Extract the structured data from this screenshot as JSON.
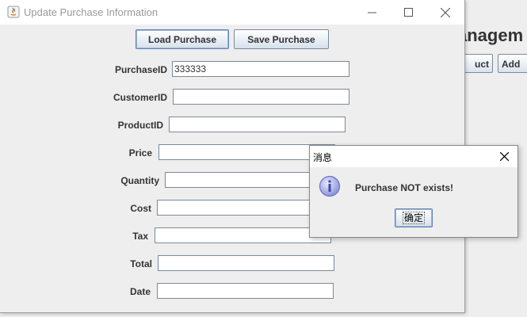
{
  "background_window": {
    "title_fragment": "anagem",
    "buttons": [
      "uct",
      "Add"
    ]
  },
  "window": {
    "title": "Update Purchase Information",
    "buttons": {
      "load": "Load Purchase",
      "save": "Save Purchase"
    }
  },
  "fields": [
    {
      "label": "PurchaseID",
      "value": "333333"
    },
    {
      "label": "CustomerID",
      "value": ""
    },
    {
      "label": "ProductID",
      "value": ""
    },
    {
      "label": "Price",
      "value": ""
    },
    {
      "label": "Quantity",
      "value": ""
    },
    {
      "label": "Cost",
      "value": ""
    },
    {
      "label": "Tax",
      "value": ""
    },
    {
      "label": "Total",
      "value": ""
    },
    {
      "label": "Date",
      "value": ""
    }
  ],
  "message_dialog": {
    "title": "消息",
    "text": "Purchase NOT exists!",
    "ok_label": "确定",
    "icon": "information-icon"
  },
  "colors": {
    "button_border": "#7b8a9b",
    "info_icon": "#6a76c9",
    "panel_bg": "#eeeeee"
  }
}
